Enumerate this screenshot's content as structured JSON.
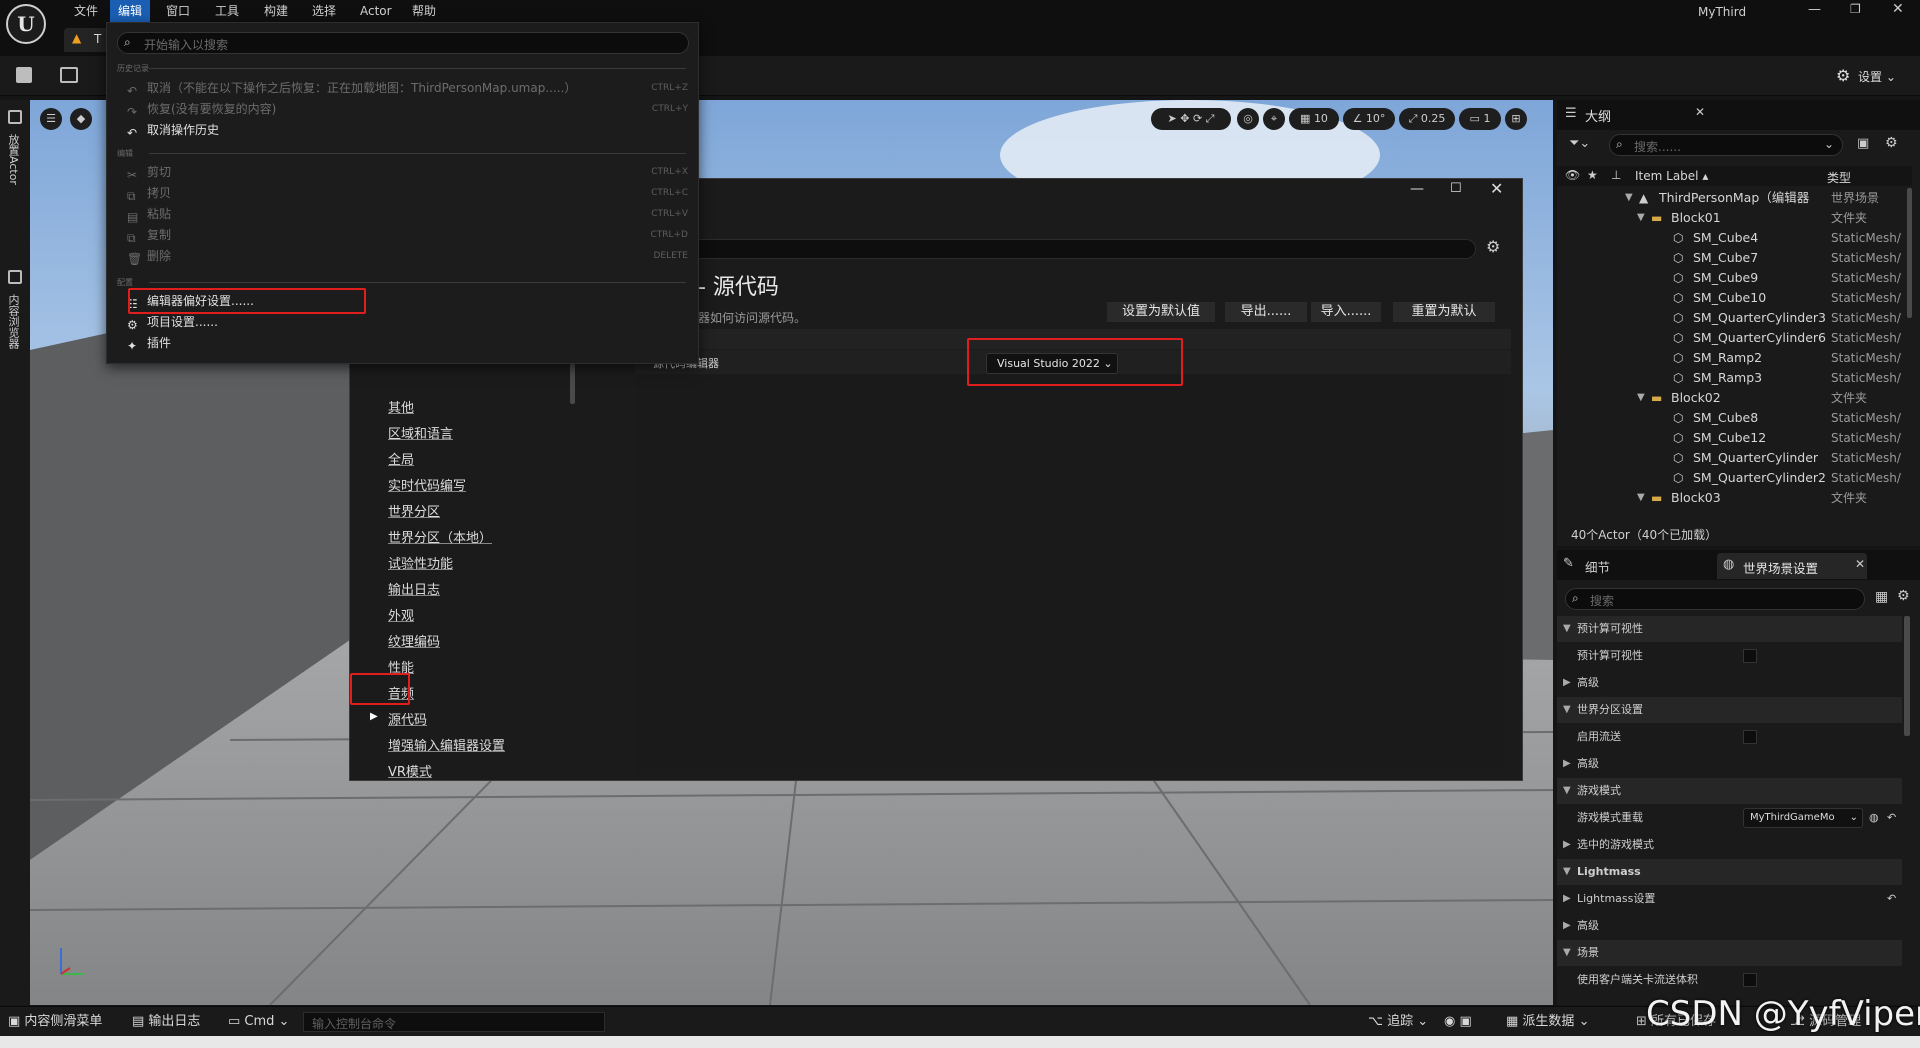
{
  "app": {
    "project": "MyThird",
    "logo": "unreal-logo-icon"
  },
  "menubar": {
    "items": [
      "文件",
      "编辑",
      "窗口",
      "工具",
      "构建",
      "选择",
      "Actor",
      "帮助"
    ]
  },
  "tab": {
    "label": "T"
  },
  "toolbar": {
    "settings_label": "设置"
  },
  "leftstrip": {
    "place_actor": "放置Actor",
    "content_browser": "内容浏览器"
  },
  "viewport": {
    "snap_grid": "10",
    "snap_rotate": "10°",
    "snap_scale": "0.25",
    "camera_speed": "1"
  },
  "editmenu": {
    "search_placeholder": "开始输入以搜索",
    "sections": {
      "history": "历史记录",
      "edit": "编辑",
      "config": "配置"
    },
    "items": [
      {
        "label": "取消（不能在以下操作之后恢复：正在加载地图：ThirdPersonMap.umap.....）",
        "shortcut": "CTRL+Z",
        "disabled": true
      },
      {
        "label": "恢复(没有要恢复的内容)",
        "shortcut": "CTRL+Y",
        "disabled": true
      },
      {
        "label": "取消操作历史",
        "shortcut": "",
        "disabled": false
      },
      {
        "label": "剪切",
        "shortcut": "CTRL+X",
        "disabled": true
      },
      {
        "label": "拷贝",
        "shortcut": "CTRL+C",
        "disabled": true
      },
      {
        "label": "粘贴",
        "shortcut": "CTRL+V",
        "disabled": true
      },
      {
        "label": "复制",
        "shortcut": "CTRL+D",
        "disabled": true
      },
      {
        "label": "删除",
        "shortcut": "DELETE",
        "disabled": true
      },
      {
        "label": "编辑器偏好设置......",
        "shortcut": "",
        "disabled": false
      },
      {
        "label": "项目设置......",
        "shortcut": "",
        "disabled": false
      },
      {
        "label": "插件",
        "shortcut": "",
        "disabled": false
      }
    ]
  },
  "prefs": {
    "heading": "- 源代码",
    "subheading": "器如何访问源代码。",
    "buttons": [
      "设置为默认值",
      "导出......",
      "导入......",
      "重置为默认"
    ],
    "property_label": "源代码编辑器",
    "property_value": "Visual Studio 2022",
    "nav": [
      "其他",
      "区域和语言",
      "全局",
      "实时代码编写",
      "世界分区",
      "世界分区（本地）",
      "试验性功能",
      "输出日志",
      "外观",
      "纹理编码",
      "性能",
      "音频",
      "源代码",
      "增强输入编辑器设置",
      "VR模式"
    ],
    "nav_selected": "源代码"
  },
  "outliner": {
    "tab": "大纲",
    "search_placeholder": "搜索......",
    "col_label": "Item Label",
    "col_type": "类型",
    "rows": [
      {
        "label": "ThirdPersonMap（编辑器",
        "type": "世界场景",
        "indent": 0,
        "kind": "world"
      },
      {
        "label": "Block01",
        "type": "文件夹",
        "indent": 1,
        "kind": "folder"
      },
      {
        "label": "SM_Cube4",
        "type": "StaticMesh/",
        "indent": 2,
        "kind": "mesh"
      },
      {
        "label": "SM_Cube7",
        "type": "StaticMesh/",
        "indent": 2,
        "kind": "mesh"
      },
      {
        "label": "SM_Cube9",
        "type": "StaticMesh/",
        "indent": 2,
        "kind": "mesh"
      },
      {
        "label": "SM_Cube10",
        "type": "StaticMesh/",
        "indent": 2,
        "kind": "mesh"
      },
      {
        "label": "SM_QuarterCylinder3",
        "type": "StaticMesh/",
        "indent": 2,
        "kind": "mesh"
      },
      {
        "label": "SM_QuarterCylinder6",
        "type": "StaticMesh/",
        "indent": 2,
        "kind": "mesh"
      },
      {
        "label": "SM_Ramp2",
        "type": "StaticMesh/",
        "indent": 2,
        "kind": "mesh"
      },
      {
        "label": "SM_Ramp3",
        "type": "StaticMesh/",
        "indent": 2,
        "kind": "mesh"
      },
      {
        "label": "Block02",
        "type": "文件夹",
        "indent": 1,
        "kind": "folder"
      },
      {
        "label": "SM_Cube8",
        "type": "StaticMesh/",
        "indent": 2,
        "kind": "mesh"
      },
      {
        "label": "SM_Cube12",
        "type": "StaticMesh/",
        "indent": 2,
        "kind": "mesh"
      },
      {
        "label": "SM_QuarterCylinder",
        "type": "StaticMesh/",
        "indent": 2,
        "kind": "mesh"
      },
      {
        "label": "SM_QuarterCylinder2",
        "type": "StaticMesh/",
        "indent": 2,
        "kind": "mesh"
      },
      {
        "label": "Block03",
        "type": "文件夹",
        "indent": 1,
        "kind": "folder"
      }
    ],
    "footer": "40个Actor（40个已加载）"
  },
  "details": {
    "tab_details": "细节",
    "tab_world": "世界场景设置",
    "search_placeholder": "搜索",
    "rows": [
      {
        "label": "预计算可视性",
        "kind": "cat",
        "open": true
      },
      {
        "label": "预计算可视性",
        "kind": "check"
      },
      {
        "label": "高级",
        "kind": "sub"
      },
      {
        "label": "世界分区设置",
        "kind": "cat",
        "open": true
      },
      {
        "label": "启用流送",
        "kind": "check"
      },
      {
        "label": "高级",
        "kind": "sub"
      },
      {
        "label": "游戏模式",
        "kind": "cat",
        "open": true
      },
      {
        "label": "游戏模式重载",
        "kind": "combo",
        "value": "MyThirdGameMo"
      },
      {
        "label": "选中的游戏模式",
        "kind": "sub"
      },
      {
        "label": "Lightmass",
        "kind": "cat",
        "open": true
      },
      {
        "label": "Lightmass设置",
        "kind": "sub",
        "reset": true
      },
      {
        "label": "高级",
        "kind": "sub"
      },
      {
        "label": "场景",
        "kind": "cat",
        "open": true
      },
      {
        "label": "使用客户端关卡流送体积",
        "kind": "check"
      }
    ]
  },
  "bottombar": {
    "content_drawer": "内容侧滑菜单",
    "output_log": "输出日志",
    "cmd": "Cmd",
    "console_placeholder": "输入控制台命令",
    "trace": "追踪",
    "derived_data": "派生数据",
    "all_saved": "所有已保存",
    "source_control": "源码管理"
  },
  "watermark": "CSDN @YyfViper"
}
